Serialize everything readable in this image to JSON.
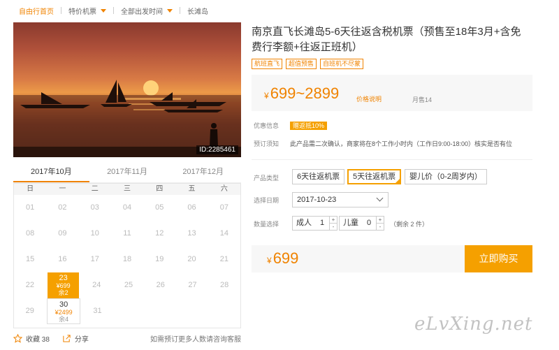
{
  "breadcrumb": {
    "home": "自由行首页",
    "items": [
      "特价机票",
      "全部出发时间",
      "长滩岛"
    ]
  },
  "photo": {
    "id_tag": "ID:2285461"
  },
  "calendar": {
    "months": [
      "2017年10月",
      "2017年11月",
      "2017年12月"
    ],
    "active_month": 0,
    "weekdays": [
      "日",
      "一",
      "二",
      "三",
      "四",
      "五",
      "六"
    ],
    "weeks": [
      [
        "01",
        "02",
        "03",
        "04",
        "05",
        "06",
        "07"
      ],
      [
        "08",
        "09",
        "10",
        "11",
        "12",
        "13",
        "14"
      ],
      [
        "15",
        "16",
        "17",
        "18",
        "19",
        "20",
        "21"
      ],
      [
        "22",
        "23",
        "24",
        "25",
        "26",
        "27",
        "28"
      ],
      [
        "29",
        "30",
        "31",
        "",
        "",
        "",
        ""
      ]
    ],
    "available": {
      "23": {
        "price": "¥699",
        "stock": "余2",
        "selected": true
      },
      "30": {
        "price": "¥2499",
        "stock": "余4",
        "selected": false
      }
    }
  },
  "actions": {
    "favorite": "收藏 38",
    "share": "分享",
    "report": "如需预订更多人数请咨询客服"
  },
  "product": {
    "title": "南京直飞长滩岛5-6天往返含税机票（预售至18年3月+含免费行李额+往返正班机）",
    "tags": [
      "航班直飞",
      "超值预售",
      "自班机不尽蒙"
    ],
    "price_range": "699~2899",
    "currency": "¥",
    "price_hint": "价格说明",
    "monthly_sales": "月售14",
    "promo_label": "优惠信息",
    "promo_badge": "赠返抵10%",
    "notice_label": "预订须知",
    "notice_text": "此产品需二次确认，商家将在8个工作小时内（工作日9:00-18:00）核实是否有位"
  },
  "form": {
    "type_label": "产品类型",
    "types": [
      "6天往返机票",
      "5天往返机票",
      "婴儿价（0-2周岁内）"
    ],
    "selected_type": 1,
    "date_label": "选择日期",
    "date_value": "2017-10-23",
    "qty_label": "数量选择",
    "adult_label": "成人",
    "adult_count": "1",
    "child_label": "儿童",
    "child_count": "0",
    "step_up": "+",
    "step_down": "-",
    "remaining": "（剩余 2 件）"
  },
  "purchase": {
    "final_price": "699",
    "buy_label": "立即购买"
  },
  "watermark": "eLvXing.net"
}
